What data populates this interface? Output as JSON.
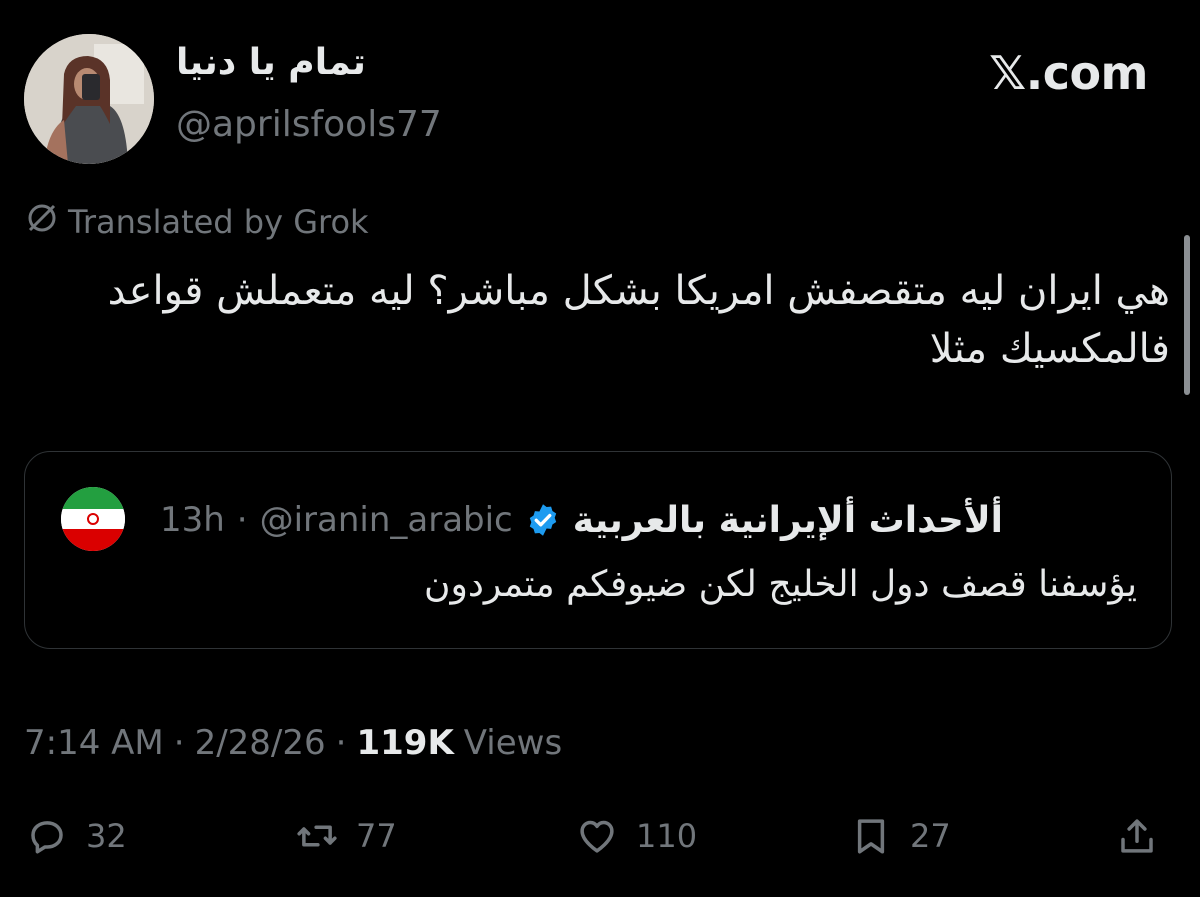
{
  "author": {
    "display_name": "تمام يا دنيا",
    "handle": "@aprilsfools77"
  },
  "brand": "𝕏.com",
  "translation_note": "Translated by Grok",
  "tweet": {
    "text": "هي ايران ليه متقصفش امريكا بشكل مباشر؟ ليه متعملش قواعد فالمكسيك مثلا"
  },
  "quoted": {
    "name": "ألأحداث ألإيرانية بالعربية",
    "handle": "@iranin_arabic",
    "separator": "·",
    "time": "13h",
    "text": "يؤسفنا قصف دول الخليج لكن ضيوفكم متمردون",
    "avatar_icon": "iran-flag-icon",
    "verified_icon": "verified-badge-icon",
    "verified_color": "#1d9bf0"
  },
  "meta": {
    "time": "7:14 AM",
    "sep1": "·",
    "date": "2/28/26",
    "sep2": "·",
    "views_count": "119K",
    "views_label": "Views"
  },
  "actions": {
    "reply": {
      "icon": "reply-icon",
      "count": "32"
    },
    "repost": {
      "icon": "repost-icon",
      "count": "77"
    },
    "like": {
      "icon": "heart-icon",
      "count": "110"
    },
    "bookmark": {
      "icon": "bookmark-icon",
      "count": "27"
    },
    "share": {
      "icon": "share-icon"
    }
  },
  "colors": {
    "background": "#000000",
    "text": "#e7e9ea",
    "muted": "#71767b",
    "border": "#2f3336"
  }
}
